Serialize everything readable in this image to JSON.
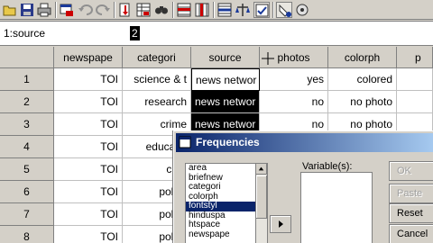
{
  "toolbar": {
    "icons": [
      "open-icon",
      "save-icon",
      "print-icon",
      "dialog-recall-icon",
      "undo-icon",
      "redo-icon",
      "goto-case-icon",
      "variables-icon",
      "find-icon",
      "insert-case-icon",
      "insert-variable-icon",
      "split-file-icon",
      "weight-cases-icon",
      "select-cases-icon",
      "value-labels-icon",
      "use-sets-icon"
    ]
  },
  "editor": {
    "cell_ref": "1:source",
    "cell_value": "2"
  },
  "grid": {
    "columns": [
      "newspape",
      "categori",
      "source",
      "photos",
      "colorph",
      "p"
    ],
    "rows": [
      {
        "n": "1",
        "cells": [
          "TOI",
          "science & t",
          "news networ",
          "yes",
          "colored",
          ""
        ]
      },
      {
        "n": "2",
        "cells": [
          "TOI",
          "research",
          "news networ",
          "no",
          "no photo",
          ""
        ]
      },
      {
        "n": "3",
        "cells": [
          "TOI",
          "crime",
          "news networ",
          "no",
          "no photo",
          ""
        ]
      },
      {
        "n": "4",
        "cells": [
          "TOI",
          "educatio",
          "",
          "",
          "",
          ""
        ]
      },
      {
        "n": "5",
        "cells": [
          "TOI",
          "crim",
          "",
          "",
          "",
          ""
        ]
      },
      {
        "n": "6",
        "cells": [
          "TOI",
          "politic",
          "",
          "",
          "",
          ""
        ]
      },
      {
        "n": "7",
        "cells": [
          "TOI",
          "politic",
          "",
          "",
          "",
          ""
        ]
      },
      {
        "n": "8",
        "cells": [
          "TOI",
          "politic",
          "",
          "",
          "",
          ""
        ]
      }
    ]
  },
  "dialog": {
    "title": "Frequencies",
    "variables": [
      "area",
      "briefnew",
      "categori",
      "colorph",
      "fontstyl",
      "hinduspa",
      "htspace",
      "newspape"
    ],
    "selected_variable": "fontstyl",
    "variables_label": "Variable(s):",
    "buttons": {
      "ok": "OK",
      "paste": "Paste",
      "reset": "Reset",
      "cancel": "Cancel"
    }
  }
}
